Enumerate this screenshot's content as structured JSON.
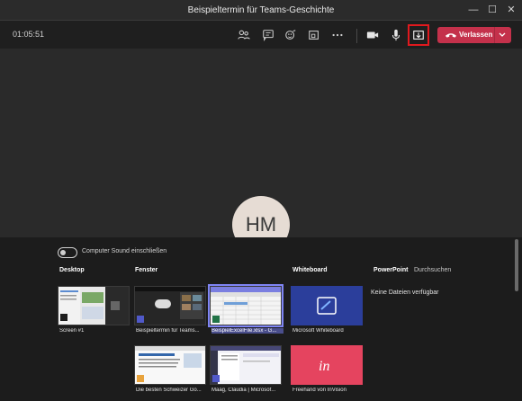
{
  "window": {
    "title": "Beispieltermin für Teams-Geschichte",
    "controls": [
      "—",
      "☐",
      "✕"
    ]
  },
  "toolbar": {
    "timer": "01:05:51",
    "leave_label": "Verlassen",
    "icons": [
      "participants-icon",
      "chat-icon",
      "reactions-icon",
      "rooms-icon",
      "more-icon",
      "camera-icon",
      "mic-icon",
      "share-tray-icon",
      "leave-phone-icon",
      "chevron-down-icon"
    ]
  },
  "stage": {
    "avatar_initials": "HM"
  },
  "tray": {
    "sound_toggle_label": "Computer Sound einschließen",
    "sections": {
      "desktop": "Desktop",
      "window": "Fenster",
      "whiteboard": "Whiteboard",
      "powerpoint": "PowerPoint",
      "browse": "Durchsuchen"
    },
    "no_files": "Keine Dateien verfügbar",
    "desktop_items": [
      {
        "label": "Screen #1"
      }
    ],
    "window_items": [
      {
        "label": "Beispieltermin für Teams..."
      },
      {
        "label": "BeispielExcelFile.xlsx - G..."
      },
      {
        "label": "Die besten Schweizer Go..."
      },
      {
        "label": "Maag, Claudia | Microsof..."
      }
    ],
    "whiteboard_items": [
      {
        "label": "Microsoft Whiteboard"
      },
      {
        "label": "Freehand von InVision"
      }
    ]
  },
  "colors": {
    "leave_button": "#c4314b",
    "share_highlight": "#e0191e",
    "selection": "#7f85f5",
    "whiteboard_tile": "#2b3e9b",
    "invision_tile": "#e5445f"
  }
}
